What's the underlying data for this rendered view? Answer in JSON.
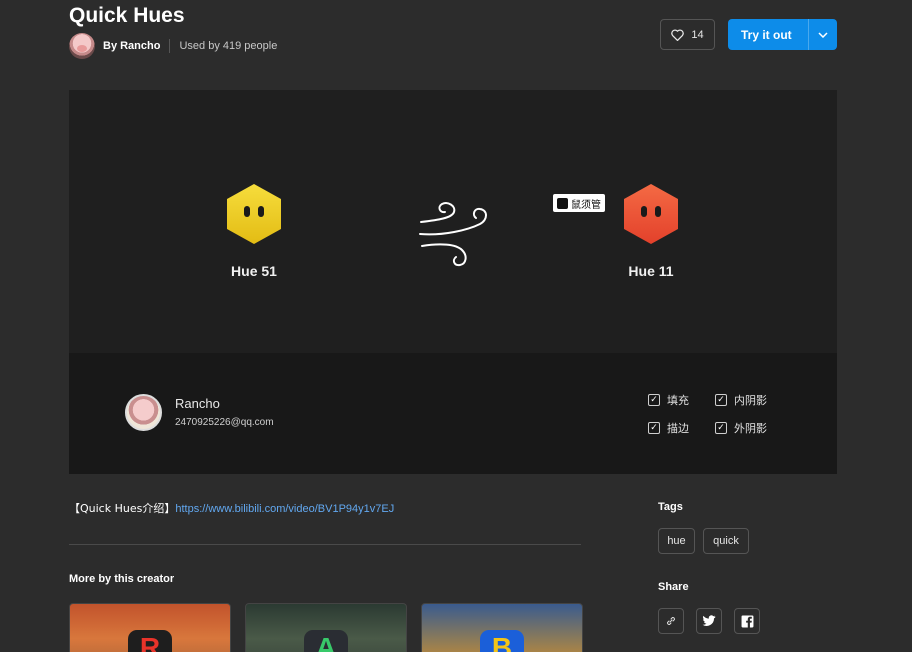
{
  "header": {
    "title": "Quick Hues",
    "author_label": "By Rancho",
    "usage_text": "Used by 419 people",
    "like_count": "14",
    "try_label": "Try it out"
  },
  "preview": {
    "left_label": "Hue 51",
    "right_label": "Hue 11",
    "badge_text": "鼠须管",
    "left_color": "#f0cf25",
    "right_color": "#f0553a",
    "creator_name": "Rancho",
    "creator_email": "2470925226@qq.com",
    "options": [
      "填充",
      "内阴影",
      "描边",
      "外阴影"
    ]
  },
  "description": {
    "prefix": "【Quick Hues介绍】",
    "link": "https://www.bilibili.com/video/BV1P94y1v7EJ"
  },
  "more": {
    "title": "More by this creator",
    "cards": [
      {
        "icon": "letter-r-icon",
        "letter": "R"
      },
      {
        "icon": "letter-a-icon",
        "letter": "A"
      },
      {
        "icon": "letter-b-icon",
        "letter": "B"
      }
    ]
  },
  "tags": {
    "title": "Tags",
    "items": [
      "hue",
      "quick"
    ]
  },
  "share": {
    "title": "Share",
    "icons": [
      "link-icon",
      "twitter-icon",
      "facebook-icon"
    ]
  }
}
